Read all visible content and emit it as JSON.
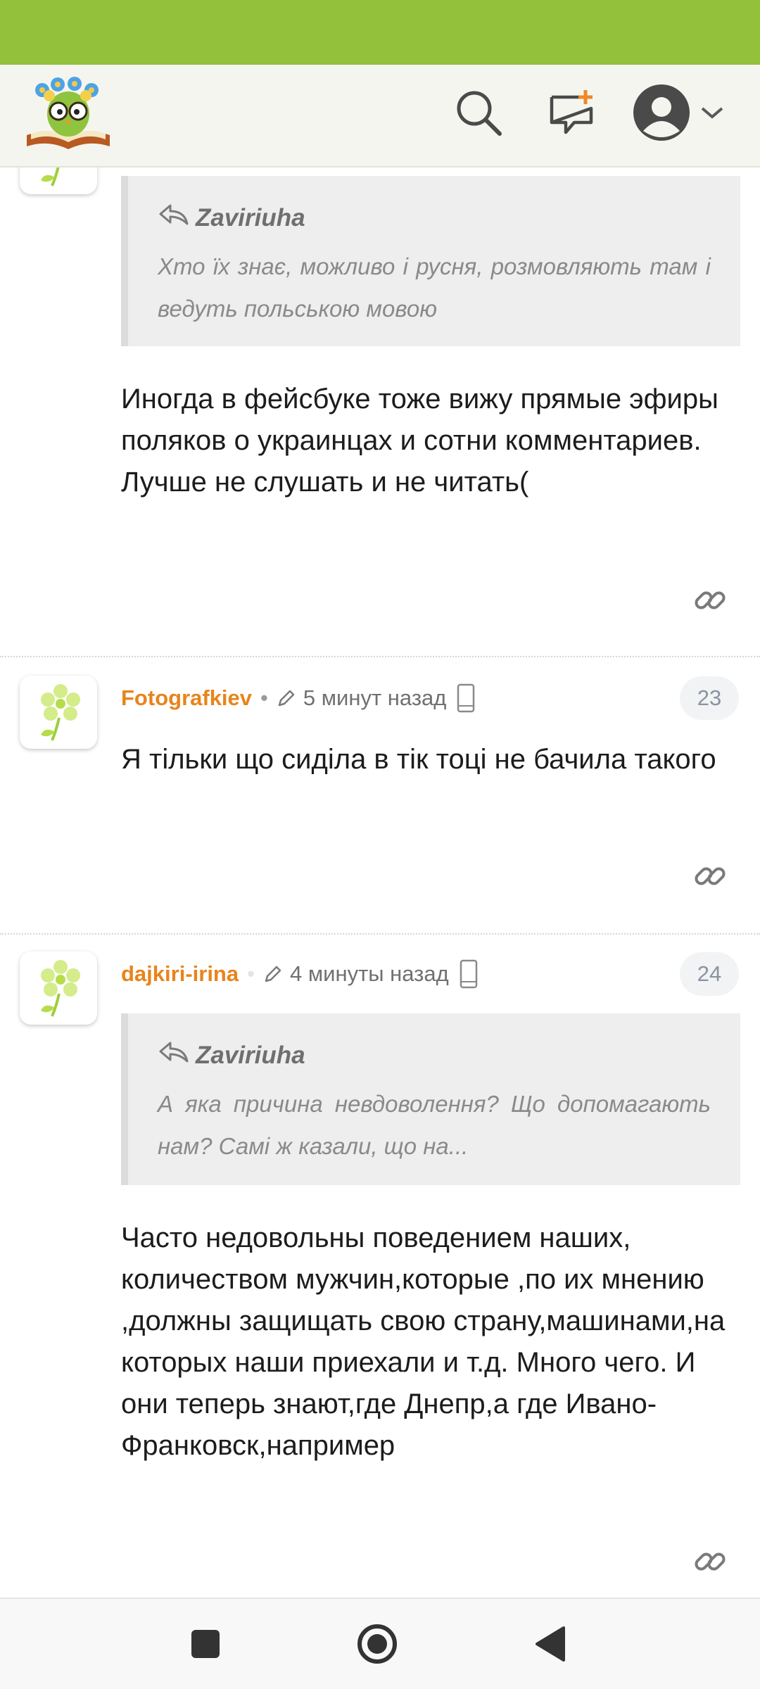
{
  "colors": {
    "status_bar": "#93c13b",
    "accent_author": "#e8841c",
    "header_bg": "#f5f5f0"
  },
  "header": {
    "logo_icon": "owl-on-book-logo",
    "search_icon": "search-icon",
    "new_message_icon": "new-message-icon",
    "account_icon": "user-avatar-icon"
  },
  "comments": [
    {
      "quote": {
        "author": "Zaviriuha",
        "text": "Хто їх знає, можливо і русня, розмовляють там і ведуть польською мовою"
      },
      "text": "Иногда в фейсбуке тоже вижу прямые эфиры поляков о украинцах и сотни комментариев. Лучше не слушать и не читать("
    },
    {
      "author": "Fotografkiev",
      "separator": "•",
      "time": "5 минут назад",
      "number": "23",
      "text": "Я тільки що сиділа в тік тоці не бачила такого"
    },
    {
      "author": "dajkiri-irina",
      "separator": "•",
      "time": "4 минуты назад",
      "number": "24",
      "quote": {
        "author": "Zaviriuha",
        "text": "А яка причина невдоволення? Що допомагають нам? Самі ж казали, що на..."
      },
      "text": "Часто недовольны поведением наших, количеством мужчин,которые ,по их мнению ,должны защищать свою страну,машинами,на которых наши приехали и т.д. Много чего. И они теперь знают,где Днепр,а где Ивано-Франковск,например"
    }
  ],
  "navbar": {
    "recents_icon": "square-recents-icon",
    "home_icon": "circle-home-icon",
    "back_icon": "triangle-back-icon"
  }
}
